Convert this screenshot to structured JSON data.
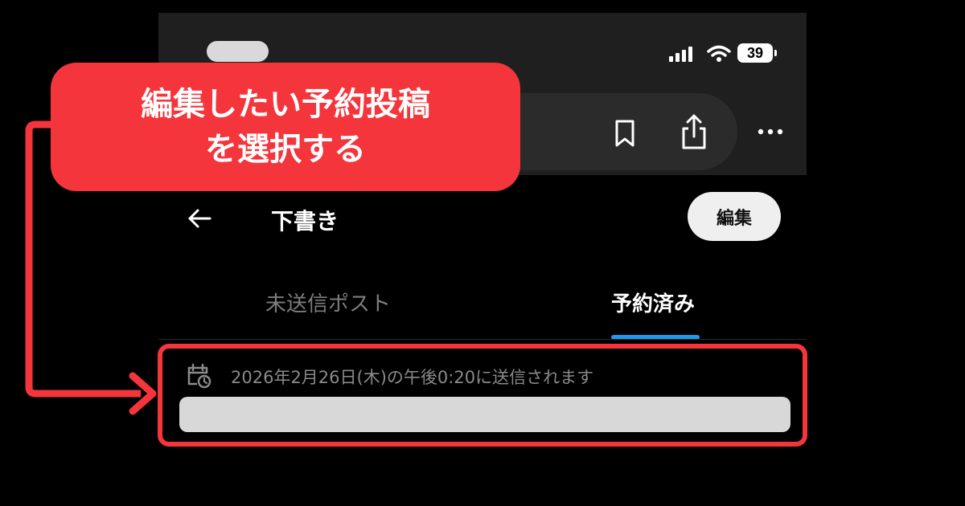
{
  "status_bar": {
    "battery": "39"
  },
  "header": {
    "title": "下書き",
    "edit_label": "編集"
  },
  "tabs": [
    {
      "label": "未送信ポスト",
      "active": false
    },
    {
      "label": "予約済み",
      "active": true
    }
  ],
  "scheduled_post": {
    "schedule_text": "2026年2月26日(木)の午後0:20に送信されます"
  },
  "annotation": {
    "line1": "編集したい予約投稿",
    "line2": "を選択する",
    "color": "#f4353b"
  },
  "colors": {
    "accent": "#1d9bf0",
    "background": "#000000"
  },
  "icons": [
    "signal-icon",
    "wifi-icon",
    "battery-icon",
    "bookmark-icon",
    "share-icon",
    "more-icon",
    "back-arrow-icon",
    "calendar-clock-icon"
  ]
}
